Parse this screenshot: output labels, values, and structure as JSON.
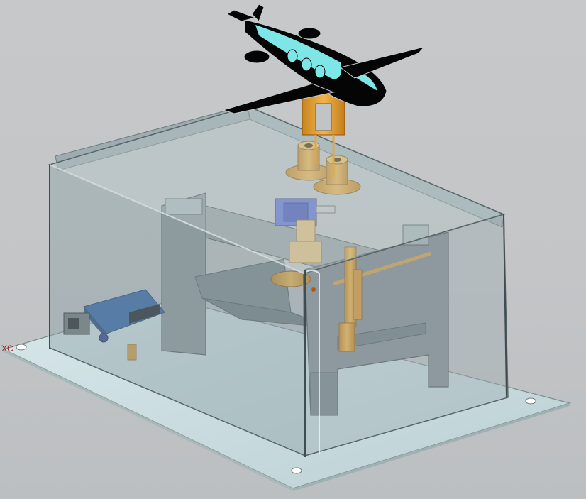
{
  "view": {
    "axis_label": "XC",
    "colors": {
      "background": "#c4c6c8",
      "base_plate": "#c9dde0",
      "enclosure_glass": "#8fa2a6",
      "frame": "#8e9598",
      "brass": "#e8a83a",
      "arduino_board": "#2b5fa6",
      "servo": "#5b6fd6",
      "airplane_body": "#050505",
      "airplane_window": "#7ee6e6"
    },
    "components": [
      "base-plate",
      "transparent-enclosure",
      "support-frame",
      "arduino-board",
      "servo-motor",
      "flange-couplers",
      "lever-linkage",
      "airplane-model"
    ]
  }
}
